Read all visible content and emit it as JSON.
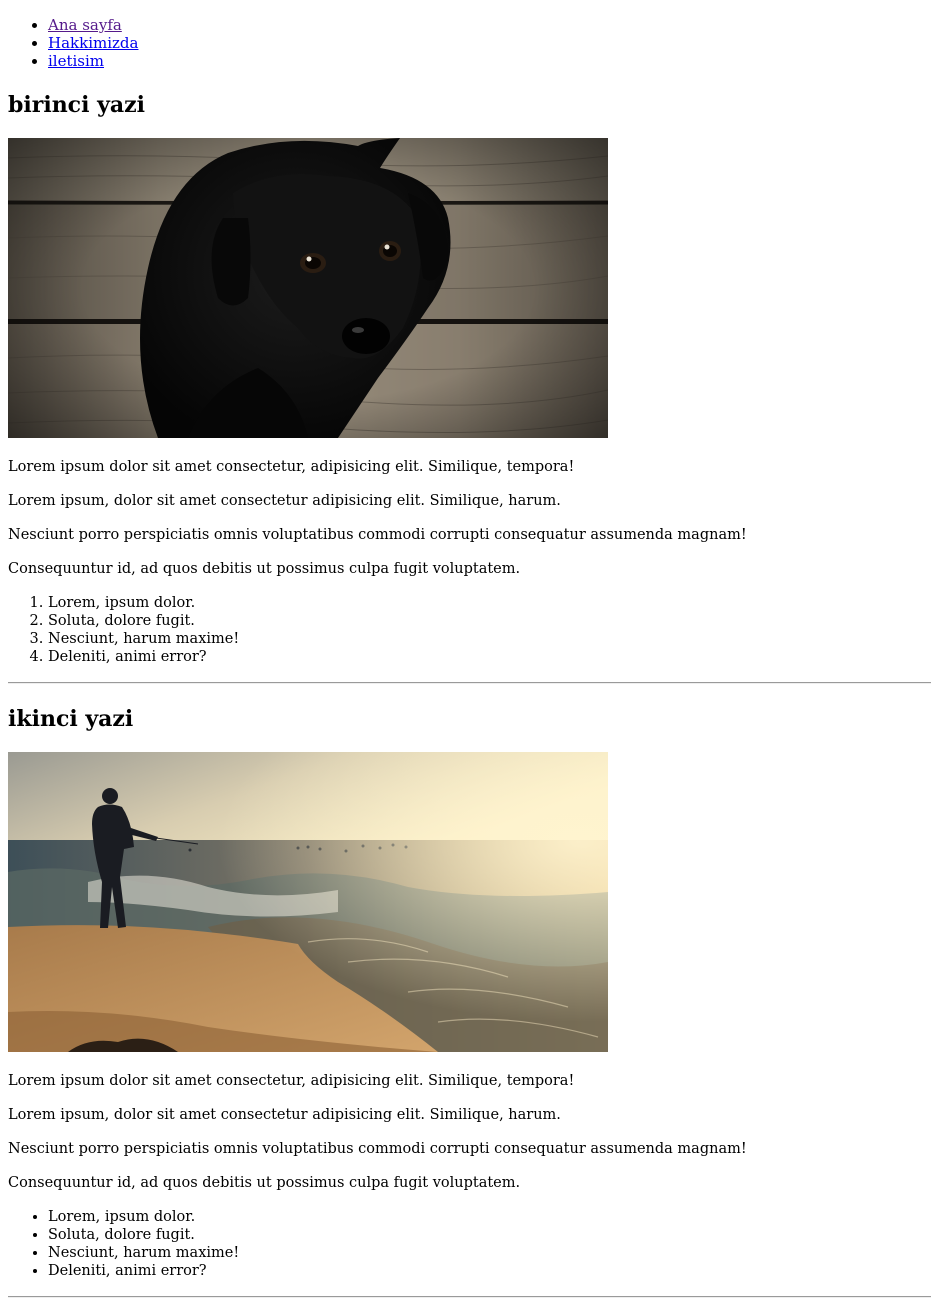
{
  "nav": {
    "items": [
      {
        "label": "Ana sayfa"
      },
      {
        "label": "Hakkimizda"
      },
      {
        "label": "iletisim"
      }
    ]
  },
  "posts": [
    {
      "title": "birinci yazi",
      "image_icon": "puppy-photo",
      "paragraphs": [
        "Lorem ipsum dolor sit amet consectetur, adipisicing elit. Similique, tempora!",
        "Lorem ipsum, dolor sit amet consectetur adipisicing elit. Similique, harum.",
        "Nesciunt porro perspiciatis omnis voluptatibus commodi corrupti consequatur assumenda magnam!",
        "Consequuntur id, ad quos debitis ut possimus culpa fugit voluptatem."
      ],
      "list": [
        "Lorem, ipsum dolor.",
        "Soluta, dolore fugit.",
        "Nesciunt, harum maxime!",
        "Deleniti, animi error?"
      ]
    },
    {
      "title": "ikinci yazi",
      "image_icon": "beach-fisherman-photo",
      "paragraphs": [
        "Lorem ipsum dolor sit amet consectetur, adipisicing elit. Similique, tempora!",
        "Lorem ipsum, dolor sit amet consectetur adipisicing elit. Similique, harum.",
        "Nesciunt porro perspiciatis omnis voluptatibus commodi corrupti consequatur assumenda magnam!",
        "Consequuntur id, ad quos debitis ut possimus culpa fugit voluptatem."
      ],
      "list": [
        "Lorem, ipsum dolor.",
        "Soluta, dolore fugit.",
        "Nesciunt, harum maxime!",
        "Deleniti, animi error?"
      ]
    }
  ],
  "colors": {
    "link_visited": "#551A8B",
    "link_unvisited": "#0000EE",
    "hr": "#9a9a9a"
  }
}
